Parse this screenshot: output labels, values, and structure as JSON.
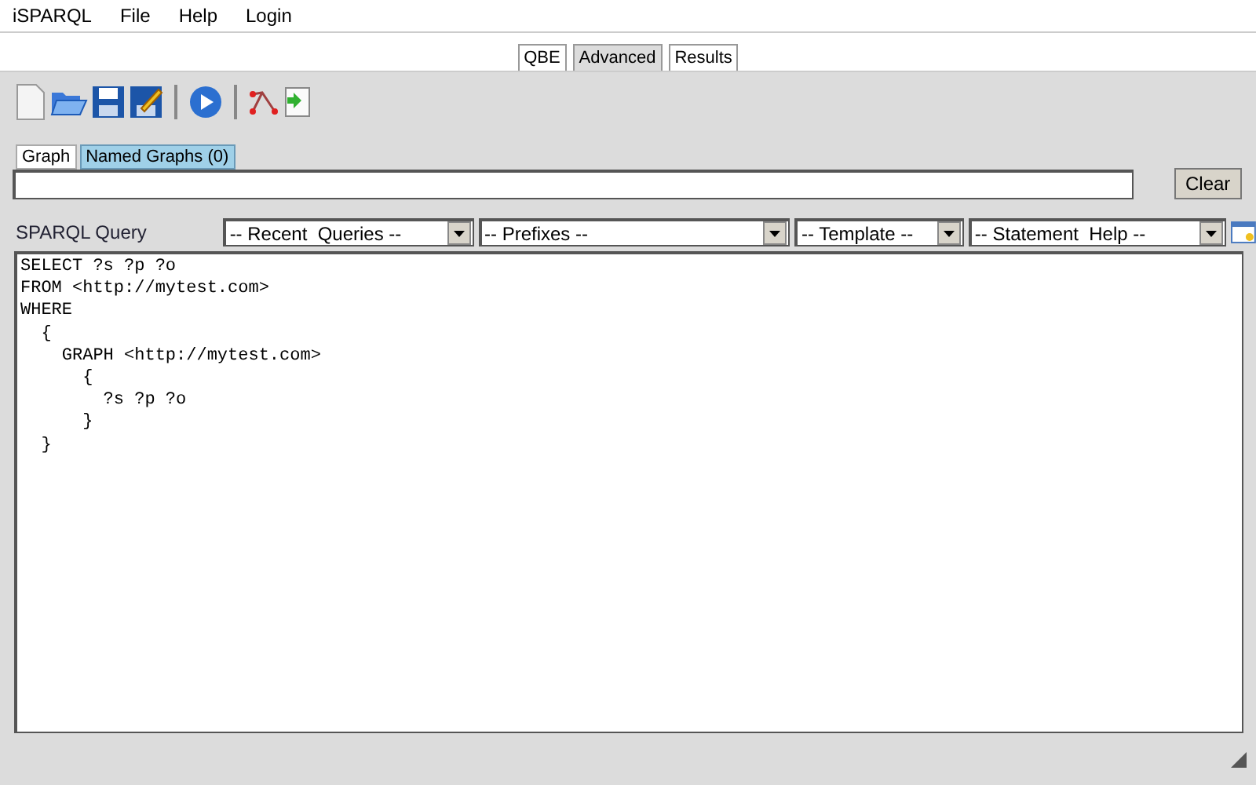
{
  "menu": [
    "iSPARQL",
    "File",
    "Help",
    "Login"
  ],
  "tabs": [
    {
      "label": "QBE",
      "selected": false
    },
    {
      "label": "Advanced",
      "selected": true
    },
    {
      "label": "Results",
      "selected": false
    }
  ],
  "toolbar": [
    {
      "kind": "new"
    },
    {
      "kind": "open"
    },
    {
      "kind": "save"
    },
    {
      "kind": "saveas"
    },
    {
      "kind": "sep"
    },
    {
      "kind": "run"
    },
    {
      "kind": "sep"
    },
    {
      "kind": "graph"
    },
    {
      "kind": "import"
    }
  ],
  "graph_tabs": [
    {
      "label": "Graph",
      "selected": false
    },
    {
      "label": "Named Graphs (0)",
      "selected": true
    }
  ],
  "clear_button": "Clear",
  "query_label": "SPARQL Query",
  "dropdowns": [
    "-- Recent  Queries --",
    "-- Prefixes --",
    "-- Template --",
    "-- Statement  Help --"
  ],
  "query": "SELECT ?s ?p ?o\nFROM <http://mytest.com>\nWHERE\n  {\n    GRAPH <http://mytest.com>\n      {\n        ?s ?p ?o\n      }\n  }"
}
